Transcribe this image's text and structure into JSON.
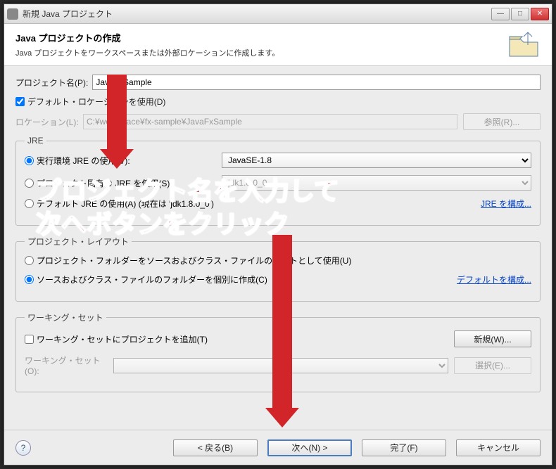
{
  "window": {
    "title": "新規 Java プロジェクト"
  },
  "banner": {
    "heading": "Java プロジェクトの作成",
    "subtext": "Java プロジェクトをワークスペースまたは外部ロケーションに作成します。"
  },
  "project": {
    "name_label": "プロジェクト名(P):",
    "name_value": "JavaFxSample",
    "use_default_label": "デフォルト・ロケーションを使用(D)",
    "location_label": "ロケーション(L):",
    "location_value": "C:¥workspace¥fx-sample¥JavaFxSample",
    "browse_label": "参照(R)..."
  },
  "jre": {
    "legend": "JRE",
    "exec_env_label": "実行環境 JRE の使用(V):",
    "exec_env_value": "JavaSE-1.8",
    "project_jre_label": "プロジェクト固有の JRE を使用(S):",
    "project_jre_value": "jdk1.8.0_0",
    "default_jre_label_prefix": "デフォルト JRE の使用(A) (現在は 'jdk1.8.0_0')",
    "configure_link": "JRE を構成..."
  },
  "layout": {
    "legend": "プロジェクト・レイアウト",
    "same_folder_label": "プロジェクト・フォルダーをソースおよびクラス・ファイルのルートとして使用(U)",
    "separate_folder_label": "ソースおよびクラス・ファイルのフォルダーを個別に作成(C)",
    "configure_link": "デフォルトを構成..."
  },
  "workingset": {
    "legend": "ワーキング・セット",
    "add_label": "ワーキング・セットにプロジェクトを追加(T)",
    "select_label": "ワーキング・セット(O):",
    "new_btn": "新規(W)...",
    "select_btn": "選択(E)..."
  },
  "buttons": {
    "back": "< 戻る(B)",
    "next": "次へ(N) >",
    "finish": "完了(F)",
    "cancel": "キャンセル"
  },
  "annotation": {
    "line1": "プロジェクト名を入力して",
    "line2": "次へボタンをクリック"
  }
}
